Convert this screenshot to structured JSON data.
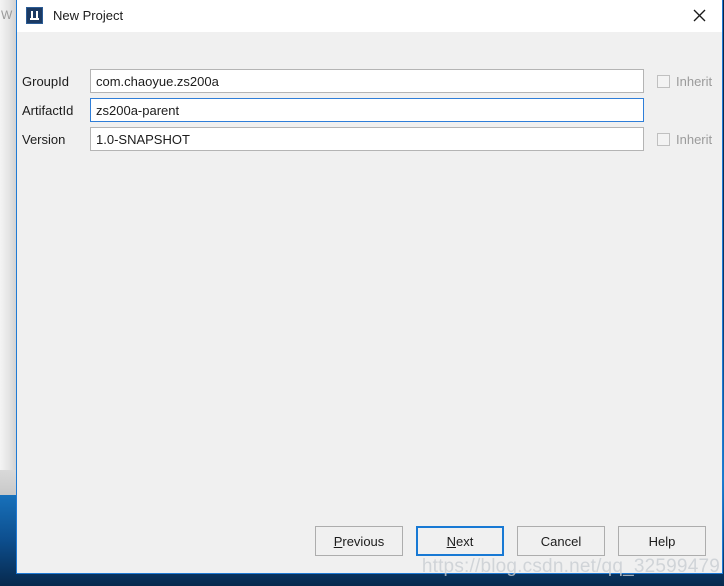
{
  "window": {
    "title": "New Project",
    "icon": "intellij-idea-icon",
    "close_icon": "close-icon",
    "border_color": "#1f7ad4",
    "titlebar_bg": "#ffffff",
    "body_bg": "#f0f0f0"
  },
  "behind": {
    "text": "W"
  },
  "form": {
    "rows": [
      {
        "label": "GroupId",
        "value": "com.chaoyue.zs200a",
        "focused": false,
        "inherit": {
          "label": "Inherit",
          "checked": false,
          "enabled": false
        }
      },
      {
        "label": "ArtifactId",
        "value": "zs200a-parent",
        "focused": true,
        "inherit": null
      },
      {
        "label": "Version",
        "value": "1.0-SNAPSHOT",
        "focused": false,
        "inherit": {
          "label": "Inherit",
          "checked": false,
          "enabled": false
        }
      }
    ]
  },
  "footer": {
    "buttons": [
      {
        "label": "Previous",
        "mnemonic": "P",
        "default": false
      },
      {
        "label": "Next",
        "mnemonic": "N",
        "default": true
      },
      {
        "label": "Cancel",
        "mnemonic": "",
        "default": false
      },
      {
        "label": "Help",
        "mnemonic": "",
        "default": false
      }
    ]
  },
  "watermark": {
    "text": "https://blog.csdn.net/qq_32599479"
  }
}
